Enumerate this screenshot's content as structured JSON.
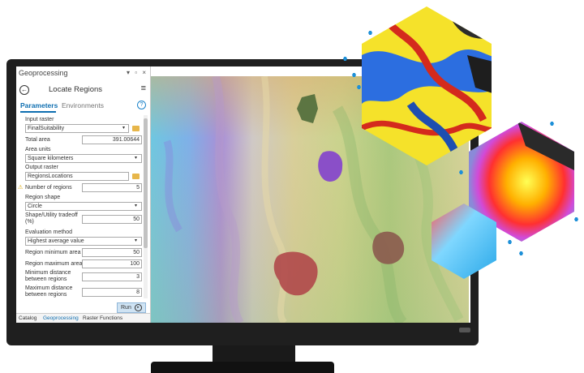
{
  "panel": {
    "title": "Geoprocessing",
    "window_controls": "▾ ▫ ×",
    "tool_title": "Locate Regions",
    "tabs": {
      "parameters": "Parameters",
      "environments": "Environments"
    },
    "help": "?"
  },
  "params": {
    "input_raster": {
      "label": "Input raster",
      "value": "FinalSuitability"
    },
    "total_area": {
      "label": "Total area",
      "value": "391.00644"
    },
    "area_units": {
      "label": "Area units",
      "value": "Square kilometers"
    },
    "output_raster": {
      "label": "Output raster",
      "value": "RegionsLocations"
    },
    "number_of_regions": {
      "label": "Number of regions",
      "value": "5"
    },
    "region_shape": {
      "label": "Region shape",
      "value": "Circle"
    },
    "shape_tradeoff": {
      "label": "Shape/Utility tradeoff (%)",
      "value": "50"
    },
    "evaluation_method": {
      "label": "Evaluation method",
      "value": "Highest average value"
    },
    "region_min_area": {
      "label": "Region minimum area",
      "value": "50"
    },
    "region_max_area": {
      "label": "Region maximum area",
      "value": "100"
    },
    "min_distance": {
      "label": "Minimum distance between regions",
      "value": "3"
    },
    "max_distance": {
      "label": "Maximum distance between regions",
      "value": "8"
    }
  },
  "run_button": "Run",
  "bottom_tabs": [
    "Catalog",
    "Geoprocessing",
    "Raster Functions"
  ],
  "colors": {
    "accent": "#0f6fb1",
    "region_purple": "#8a4fc8",
    "region_red": "#b0484a",
    "region_brown": "#8b5a4e",
    "region_darkgreen": "#4f6b3a"
  },
  "icons": {
    "back": "←",
    "menu": "≡",
    "run": "▸",
    "dropdown": "▾"
  }
}
